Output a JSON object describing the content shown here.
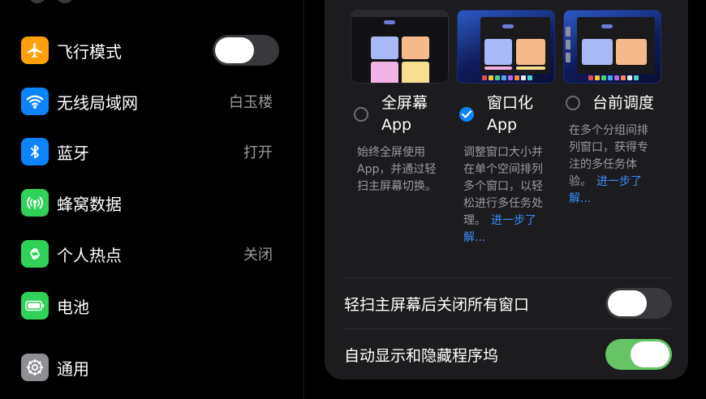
{
  "sidebar": {
    "items": [
      {
        "label": "飞行模式",
        "icon": "airplane-icon",
        "color": "#ff9f0a",
        "toggle": "off"
      },
      {
        "label": "无线局域网",
        "value": "白玉楼",
        "icon": "wifi-icon",
        "color": "#0a84ff"
      },
      {
        "label": "蓝牙",
        "value": "打开",
        "icon": "bluetooth-icon",
        "color": "#0a84ff"
      },
      {
        "label": "蜂窝数据",
        "icon": "antenna-icon",
        "color": "#30d158"
      },
      {
        "label": "个人热点",
        "value": "关闭",
        "icon": "chain-link-icon",
        "color": "#30d158"
      },
      {
        "label": "电池",
        "icon": "battery-icon",
        "color": "#30d158"
      },
      {
        "label": "通用",
        "icon": "gear-icon",
        "color": "#8e8e93"
      }
    ]
  },
  "multitasking": {
    "options": [
      {
        "title_line1": "全屏幕",
        "title_line2": "App",
        "selected": false,
        "desc_line1": "始终全屏使用",
        "desc_line2": "App，并通过轻",
        "desc_line3": "扫主屏幕切换。"
      },
      {
        "title_line1": "窗口化",
        "title_line2": "App",
        "selected": true,
        "desc_line1": "调整窗口大小并",
        "desc_line2": "在单个空间排列",
        "desc_line3": "多个窗口，以轻",
        "desc_line4": "松进行多任务处",
        "desc_line5": "理。",
        "link_part1": "进一步了",
        "link_part2": "解..."
      },
      {
        "title_line1": "台前调度",
        "selected": false,
        "desc_line1": "在多个分组间排",
        "desc_line2": "列窗口，获得专",
        "desc_line3": "注的多任务体",
        "desc_line4": "验。",
        "link_part1": "进一步了",
        "link_part2": "解..."
      }
    ]
  },
  "settings": [
    {
      "label": "轻扫主屏幕后关闭所有窗口",
      "toggle": "off"
    },
    {
      "label": "自动显示和隐藏程序坞",
      "toggle": "on"
    }
  ],
  "colors": {
    "accent": "#0a84ff",
    "toggle_on": "#65c466",
    "link": "#3a8cff"
  }
}
